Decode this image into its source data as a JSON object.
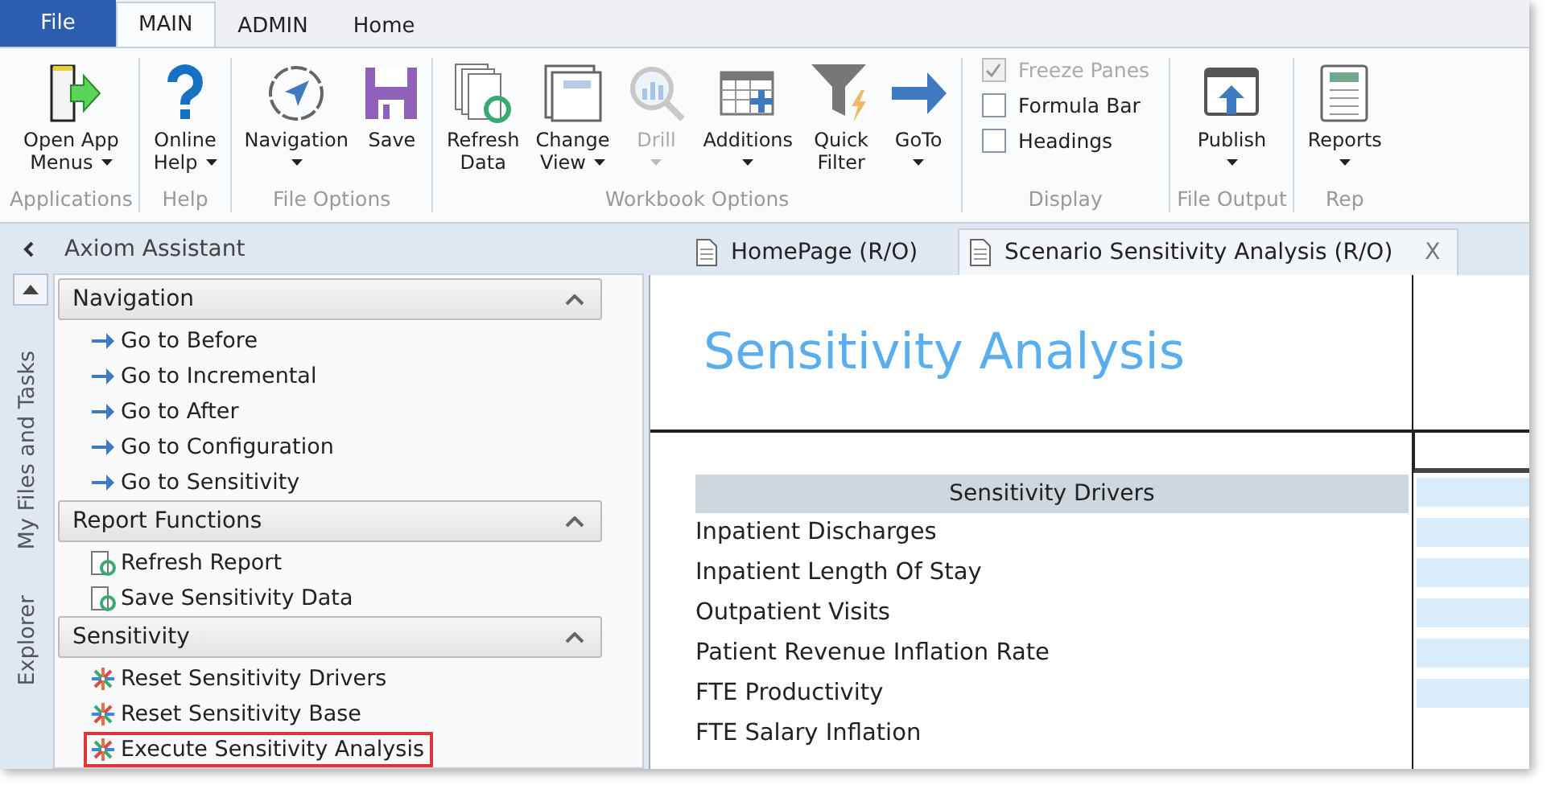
{
  "tabs": [
    {
      "label": "File",
      "kind": "file",
      "selected": false
    },
    {
      "label": "MAIN",
      "kind": "tab",
      "selected": true
    },
    {
      "label": "ADMIN",
      "kind": "tab",
      "selected": false
    },
    {
      "label": "Home",
      "kind": "tab",
      "selected": false
    }
  ],
  "ribbon": {
    "groups": [
      {
        "label": "Applications",
        "items": [
          {
            "kind": "button",
            "label": "Open App\nMenus",
            "dropdown": true,
            "disabled": false
          }
        ]
      },
      {
        "label": "Help",
        "items": [
          {
            "kind": "button",
            "label": "Online\nHelp",
            "dropdown": true,
            "disabled": false
          }
        ]
      },
      {
        "label": "File Options",
        "items": [
          {
            "kind": "button",
            "label": "Navigation",
            "dropdown": true,
            "disabled": false
          },
          {
            "kind": "button",
            "label": "Save",
            "dropdown": false,
            "disabled": false
          }
        ]
      },
      {
        "label": "Workbook Options",
        "items": [
          {
            "kind": "button",
            "label": "Refresh\nData",
            "dropdown": false,
            "disabled": false
          },
          {
            "kind": "button",
            "label": "Change\nView",
            "dropdown": true,
            "disabled": false
          },
          {
            "kind": "button",
            "label": "Drill",
            "dropdown": true,
            "disabled": true
          },
          {
            "kind": "button",
            "label": "Additions",
            "dropdown": true,
            "disabled": false
          },
          {
            "kind": "button",
            "label": "Quick\nFilter",
            "dropdown": false,
            "disabled": false
          },
          {
            "kind": "button",
            "label": "GoTo",
            "dropdown": true,
            "disabled": false
          }
        ]
      },
      {
        "label": "Display",
        "items": [
          {
            "kind": "checkbox",
            "label": "Freeze Panes",
            "checked": true,
            "disabled": true
          },
          {
            "kind": "checkbox",
            "label": "Formula Bar",
            "checked": false,
            "disabled": false
          },
          {
            "kind": "checkbox",
            "label": "Headings",
            "checked": false,
            "disabled": false
          }
        ]
      },
      {
        "label": "File Output",
        "items": [
          {
            "kind": "button",
            "label": "Publish",
            "dropdown": true,
            "disabled": false
          }
        ]
      },
      {
        "label": "Rep",
        "items": [
          {
            "kind": "button",
            "label": "Reports",
            "dropdown": true,
            "disabled": false
          }
        ]
      }
    ]
  },
  "assistant": {
    "title": "Axiom Assistant",
    "side_tabs": [
      "My Files and Tasks",
      "Explorer"
    ],
    "sections": [
      {
        "title": "Navigation",
        "expanded": true,
        "items": [
          {
            "label": "Go to Before",
            "highlighted": false
          },
          {
            "label": "Go to Incremental",
            "highlighted": false
          },
          {
            "label": "Go to After",
            "highlighted": false
          },
          {
            "label": "Go to Configuration",
            "highlighted": false
          },
          {
            "label": "Go to Sensitivity",
            "highlighted": false
          }
        ]
      },
      {
        "title": "Report Functions",
        "expanded": true,
        "items": [
          {
            "label": "Refresh Report",
            "highlighted": false
          },
          {
            "label": "Save Sensitivity Data",
            "highlighted": false
          }
        ]
      },
      {
        "title": "Sensitivity",
        "expanded": true,
        "items": [
          {
            "label": "Reset Sensitivity Drivers",
            "highlighted": false
          },
          {
            "label": "Reset Sensitivity Base",
            "highlighted": false
          },
          {
            "label": "Execute Sensitivity Analysis",
            "highlighted": true
          }
        ]
      }
    ]
  },
  "documents": [
    {
      "label": "HomePage (R/O)",
      "selected": false,
      "closable": false
    },
    {
      "label": "Scenario Sensitivity Analysis (R/O)",
      "selected": true,
      "closable": true,
      "close": "X"
    }
  ],
  "sheet": {
    "title": "Sensitivity Analysis",
    "header": "Sensitivity Drivers",
    "rows": [
      "Inpatient Discharges",
      "Inpatient Length Of Stay",
      "Outpatient Visits",
      "Patient Revenue Inflation Rate",
      "FTE Productivity",
      "FTE Salary Inflation"
    ]
  }
}
